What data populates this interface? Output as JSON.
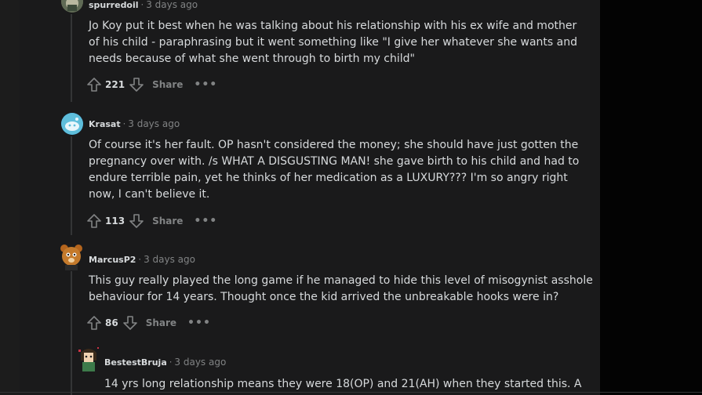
{
  "comments": [
    {
      "author": "spurredoil",
      "time": "3 days ago",
      "lines": [
        "Jo Koy put it best when he was talking about his relationship with his ex wife and mother",
        "of his child - paraphrasing but it went something like \"I give her whatever she wants and",
        "needs because of what she went through to birth my child\""
      ],
      "score": "221",
      "share_label": "Share",
      "more_label": "•••"
    },
    {
      "author": "Krasat",
      "time": "3 days ago",
      "lines": [
        "Of course it's her fault. OP hasn't considered the money; she should have just gotten the",
        "pregnancy over with. /s WHAT A DISGUSTING MAN! she gave birth to his child and had to",
        "endure terrible pain, yet he thinks of her medication as a LUXURY??? I'm so angry right",
        "now, I can't believe it."
      ],
      "score": "113",
      "share_label": "Share",
      "more_label": "•••"
    },
    {
      "author": "MarcusP2",
      "time": "3 days ago",
      "lines": [
        "This guy really played the long game if he managed to hide this level of misogynist asshole",
        "behaviour for 14 years. Thought once the kid arrived the unbreakable hooks were in?"
      ],
      "score": "86",
      "share_label": "Share",
      "more_label": "•••"
    },
    {
      "author": "BestestBruja",
      "time": "3 days ago",
      "lines": [
        "14 yrs long relationship means they were 18(OP) and 21(AH) when they started this. A"
      ]
    }
  ],
  "separator": "·",
  "colors": {
    "background": "#030303",
    "panel": "#1a1a1b",
    "text": "#d7dadc",
    "muted": "#818384",
    "thread_line": "#343536"
  },
  "icons": [
    "upvote-icon",
    "downvote-icon",
    "more-options-icon"
  ]
}
